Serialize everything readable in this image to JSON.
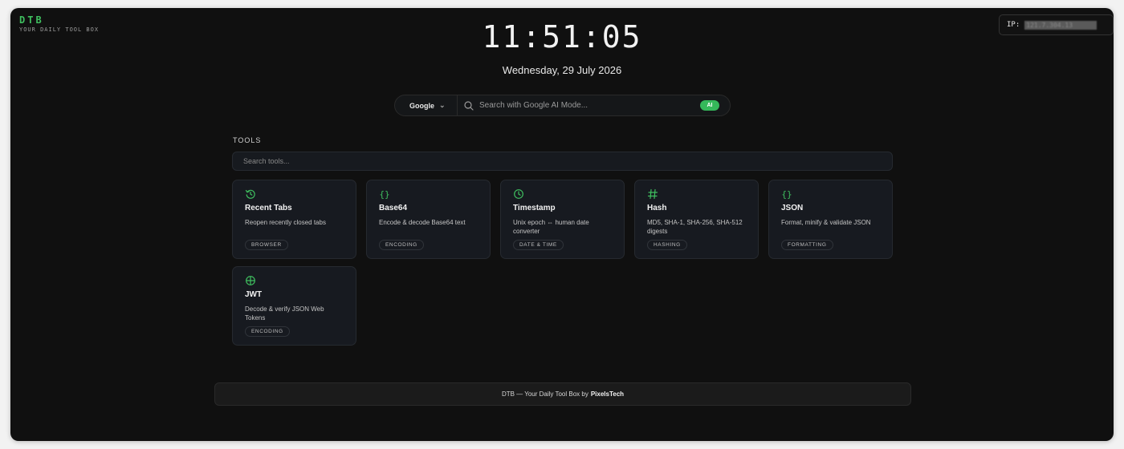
{
  "brand": {
    "name": "DTB",
    "tagline": "YOUR DAILY TOOL BOX"
  },
  "ip": {
    "label": "IP:",
    "value": "121.7.304.13"
  },
  "clock": {
    "time": "11:51:05",
    "date": "Wednesday, 29 July 2026"
  },
  "search": {
    "engine": "Google",
    "placeholder": "Search with Google AI Mode...",
    "ai_badge": "AI"
  },
  "tools": {
    "heading": "TOOLS",
    "search_placeholder": "Search tools...",
    "cards": [
      {
        "icon": "history-icon",
        "title": "Recent Tabs",
        "desc": "Reopen recently closed tabs",
        "tag": "BROWSER"
      },
      {
        "icon": "braces-icon",
        "title": "Base64",
        "desc": "Encode & decode Base64 text",
        "tag": "ENCODING"
      },
      {
        "icon": "clock-icon",
        "title": "Timestamp",
        "desc": "Unix epoch ⇔ human date converter",
        "tag": "DATE & TIME"
      },
      {
        "icon": "hash-icon",
        "title": "Hash",
        "desc": "MD5, SHA-1, SHA-256, SHA-512 digests",
        "tag": "HASHING"
      },
      {
        "icon": "braces-icon",
        "title": "JSON",
        "desc": "Format, minify & validate JSON",
        "tag": "FORMATTING"
      },
      {
        "icon": "globe-icon",
        "title": "JWT",
        "desc": "Decode & verify JSON Web Tokens",
        "tag": "ENCODING"
      }
    ]
  },
  "footer": {
    "text": "DTB — Your Daily Tool Box by",
    "author": "PixelsTech"
  },
  "colors": {
    "accent": "#3fbf5f",
    "background": "#101010",
    "card": "#171a20"
  }
}
